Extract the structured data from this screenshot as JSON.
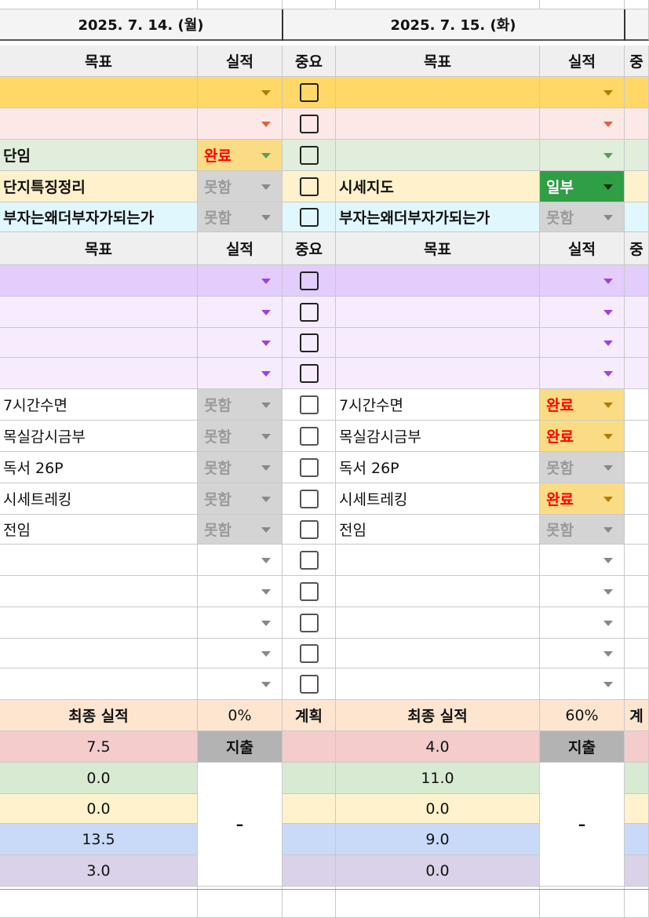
{
  "days": [
    {
      "date": "2025. 7. 14. (월)",
      "final_pct": "0%",
      "expense_label": "지출",
      "expense_value": "–",
      "section1": [
        {
          "goal": "",
          "result": ""
        },
        {
          "goal": "",
          "result": ""
        },
        {
          "goal": "단임",
          "result": "완료"
        },
        {
          "goal": "단지특징정리",
          "result": "못함"
        },
        {
          "goal": "부자는왜더부자가되는가",
          "result": "못함"
        }
      ],
      "section2": [
        {
          "goal": "",
          "result": ""
        },
        {
          "goal": "",
          "result": ""
        },
        {
          "goal": "",
          "result": ""
        },
        {
          "goal": "",
          "result": ""
        },
        {
          "goal": "7시간수면",
          "result": "못함"
        },
        {
          "goal": "목실감시금부",
          "result": "못함"
        },
        {
          "goal": "독서 26P",
          "result": "못함"
        },
        {
          "goal": "시세트레킹",
          "result": "못함"
        },
        {
          "goal": "전임",
          "result": "못함"
        },
        {
          "goal": "",
          "result": ""
        },
        {
          "goal": "",
          "result": ""
        },
        {
          "goal": "",
          "result": ""
        },
        {
          "goal": "",
          "result": ""
        },
        {
          "goal": "",
          "result": ""
        }
      ],
      "summary": [
        "7.5",
        "0.0",
        "0.0",
        "13.5",
        "3.0"
      ]
    },
    {
      "date": "2025. 7. 15. (화)",
      "final_pct": "60%",
      "expense_label": "지출",
      "expense_value": "–",
      "section1": [
        {
          "goal": "",
          "result": ""
        },
        {
          "goal": "",
          "result": ""
        },
        {
          "goal": "",
          "result": ""
        },
        {
          "goal": "시세지도",
          "result": "일부"
        },
        {
          "goal": "부자는왜더부자가되는가",
          "result": "못함"
        }
      ],
      "section2": [
        {
          "goal": "",
          "result": ""
        },
        {
          "goal": "",
          "result": ""
        },
        {
          "goal": "",
          "result": ""
        },
        {
          "goal": "",
          "result": ""
        },
        {
          "goal": "7시간수면",
          "result": "완료"
        },
        {
          "goal": "목실감시금부",
          "result": "완료"
        },
        {
          "goal": "독서 26P",
          "result": "못함"
        },
        {
          "goal": "시세트레킹",
          "result": "완료"
        },
        {
          "goal": "전임",
          "result": "못함"
        },
        {
          "goal": "",
          "result": ""
        },
        {
          "goal": "",
          "result": ""
        },
        {
          "goal": "",
          "result": ""
        },
        {
          "goal": "",
          "result": ""
        },
        {
          "goal": "",
          "result": ""
        }
      ],
      "summary": [
        "4.0",
        "11.0",
        "0.0",
        "9.0",
        "0.0"
      ]
    }
  ],
  "headers": {
    "goal": "목표",
    "result": "실적",
    "important": "중요",
    "important_partial": "중",
    "final": "최종 실적",
    "plan": "계획",
    "plan_partial": "계"
  },
  "colors": {
    "sec1_rows": [
      "#ffd868",
      "#fde8e8",
      "#e1eedb",
      "#fff1cc",
      "#dff7fd"
    ],
    "sec2_rows": [
      "#e2cdfd",
      "#f6ecfd",
      "#f6ecfd",
      "#f6ecfd",
      "#ffffff",
      "#ffffff",
      "#ffffff",
      "#ffffff",
      "#ffffff",
      "#ffffff",
      "#ffffff",
      "#ffffff",
      "#ffffff",
      "#ffffff"
    ],
    "sec1_arrows": [
      "#b07d00",
      "#e06040",
      "#5a9d5a",
      "#888888",
      "#888888"
    ],
    "sec2_arrows": [
      "#a040e0",
      "#a040e0",
      "#a040e0",
      "#a040e0"
    ],
    "summary_rows": [
      "#f4cccc",
      "#d9ead3",
      "#fff2cc",
      "#c9daf8",
      "#d9d2e9"
    ],
    "final_bg": "#fde5cf",
    "status_done_bg": "#fbdc86",
    "status_done_fg": "#ff0000",
    "status_partial_bg": "#2f9e44",
    "status_partial_fg": "#ffffff",
    "status_none_bg": "#d4d4d4",
    "status_none_fg": "#9a9a9a",
    "expense_bg": "#b3b3b3"
  }
}
